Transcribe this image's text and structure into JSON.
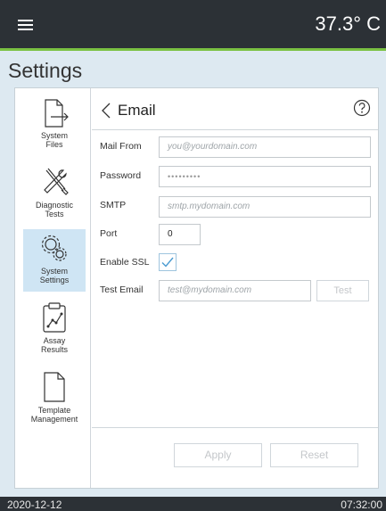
{
  "header": {
    "temperature": "37.3° C",
    "menu_icon": "hamburger-menu-icon"
  },
  "page": {
    "title": "Settings"
  },
  "sidebar": {
    "items": [
      {
        "label_line1": "System",
        "label_line2": "Files",
        "icon": "file-export-icon"
      },
      {
        "label_line1": "Diagnostic",
        "label_line2": "Tests",
        "icon": "tools-icon"
      },
      {
        "label_line1": "System",
        "label_line2": "Settings",
        "icon": "gears-icon",
        "active": true
      },
      {
        "label_line1": "Assay",
        "label_line2": "Results",
        "icon": "clipboard-chart-icon"
      },
      {
        "label_line1": "Template",
        "label_line2": "Management",
        "icon": "document-icon"
      }
    ]
  },
  "email": {
    "title": "Email",
    "help_icon": "question-circle-icon",
    "mail_from": {
      "label": "Mail From",
      "placeholder": "you@yourdomain.com"
    },
    "password": {
      "label": "Password",
      "value": "•••••••••"
    },
    "smtp": {
      "label": "SMTP",
      "placeholder": "smtp.mydomain.com"
    },
    "port": {
      "label": "Port",
      "value": "0"
    },
    "enable_ssl": {
      "label": "Enable SSL",
      "checked": true
    },
    "test_email": {
      "label": "Test Email",
      "placeholder": "test@mydomain.com",
      "button": "Test"
    },
    "apply_label": "Apply",
    "reset_label": "Reset"
  },
  "status_bar": {
    "date": "2020-12-12",
    "time": "07:32:00"
  },
  "colors": {
    "accent": "#7ac143",
    "active_nav": "#cfe5f4",
    "background": "#dde9f1",
    "topbar": "#2c3136"
  }
}
